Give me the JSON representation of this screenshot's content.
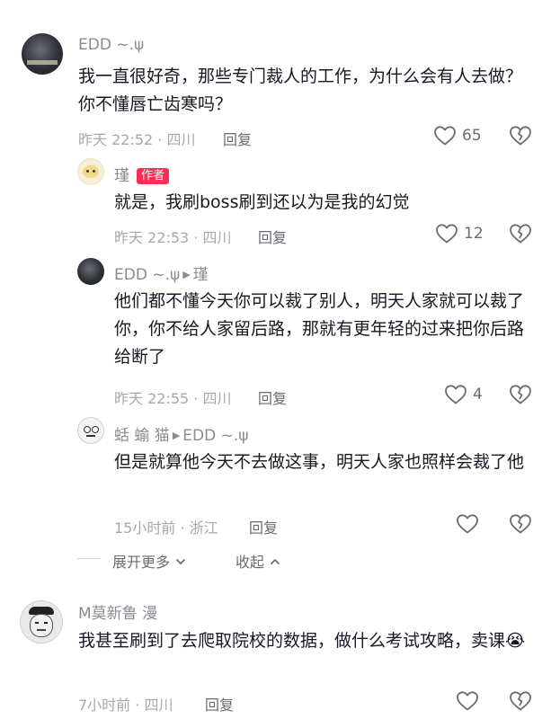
{
  "comments": [
    {
      "username": "EDD ~.ψ",
      "text": "我一直很好奇，那些专门裁人的工作，为什么会有人去做？你不懂唇亡齿寒吗？",
      "meta": "昨天 22:52 · 四川",
      "reply_label": "回复",
      "likes": "65"
    },
    {
      "username": "瑾",
      "badge": "作者",
      "text": "就是，我刷boss刷到还以为是我的幻觉",
      "meta": "昨天 22:53 · 四川",
      "reply_label": "回复",
      "likes": "12"
    },
    {
      "username": "EDD ~.ψ",
      "reply_to": "瑾",
      "text": "他们都不懂今天你可以裁了别人，明天人家就可以裁了你，你不给人家留后路，那就有更年轻的过来把你后路给断了",
      "meta": "昨天 22:55 · 四川",
      "reply_label": "回复",
      "likes": "4"
    },
    {
      "username": "蛞 蝓 猫",
      "reply_to": "EDD ~.ψ",
      "text": "但是就算他今天不去做这事，明天人家也照样会裁了他",
      "meta": "15小时前 · 浙江",
      "reply_label": "回复",
      "likes": ""
    },
    {
      "username": "M莫新鲁 漫",
      "text": "我甚至刷到了去爬取院校的数据，做什么考试攻略，卖课",
      "emoji": "😭",
      "meta": "7小时前 · 四川",
      "reply_label": "回复",
      "likes": ""
    }
  ],
  "thread_controls": {
    "expand_more": "展开更多",
    "collapse": "收起"
  },
  "icons": {
    "like": "heart-outline-icon",
    "dislike": "broken-heart-icon",
    "expand": "chevron-down-icon",
    "collapse": "chevron-up-icon",
    "reply_arrow": "triangle-right-icon"
  },
  "colors": {
    "author_badge": "#fe2c55",
    "meta_text": "#a7a8ad",
    "username_text": "#8a8b91"
  }
}
